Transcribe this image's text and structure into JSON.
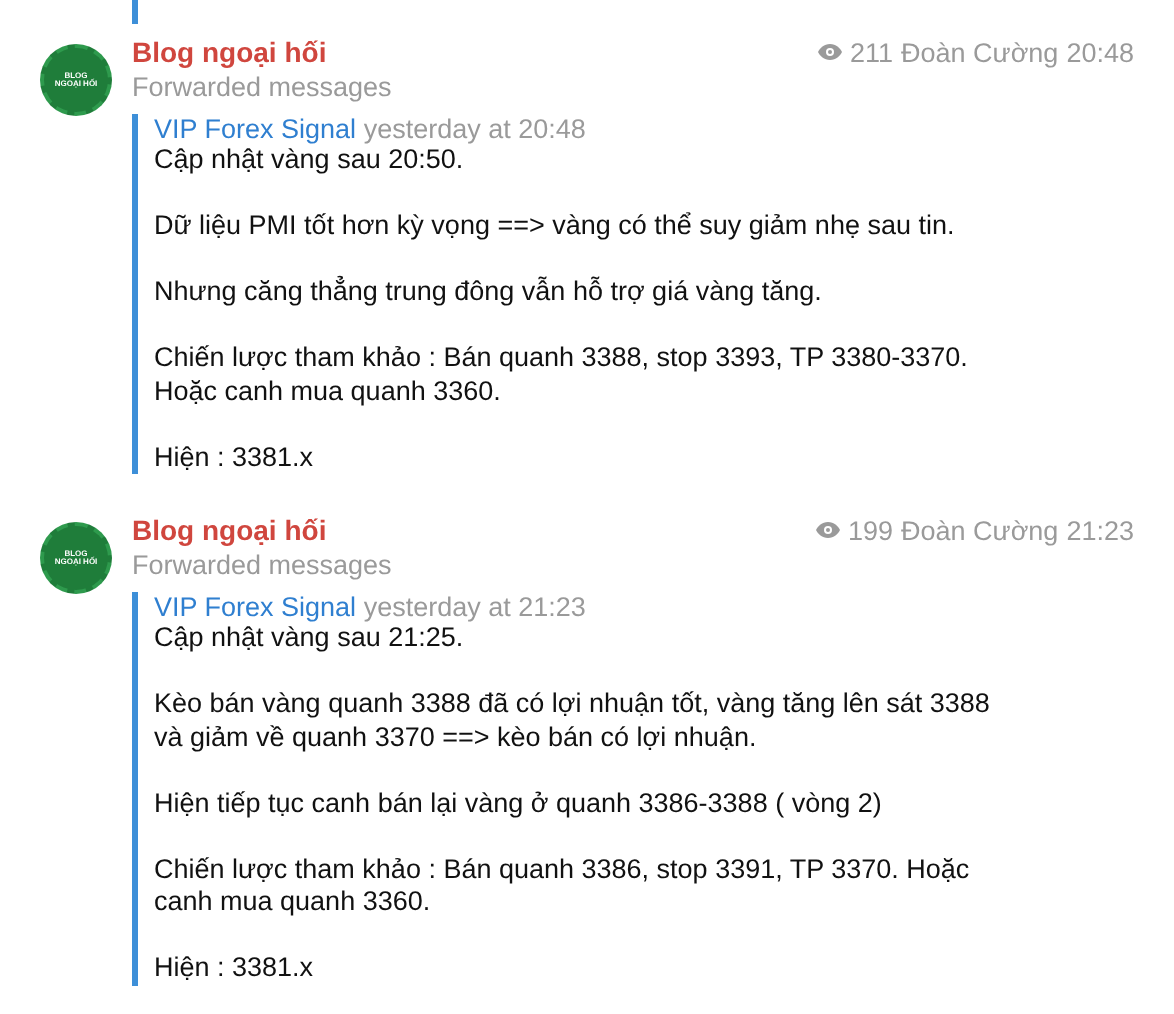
{
  "messages": [
    {
      "channel": "Blog ngoại hối",
      "avatar_text": "BLOG NGOẠI HỐI",
      "subtitle": "Forwarded messages",
      "views": "211",
      "author": "Đoàn Cường",
      "time": "20:48",
      "forward": {
        "source": "VIP Forex Signal",
        "time": "yesterday at 20:48",
        "paragraphs": [
          "Cập nhật vàng sau 20:50.",
          "Dữ liệu PMI tốt hơn kỳ vọng ==> vàng có thể suy giảm nhẹ sau tin.",
          "Nhưng căng thẳng trung đông vẫn hỗ trợ giá vàng tăng.",
          "Chiến lược tham khảo : Bán quanh 3388, stop 3393, TP 3380-3370.\nHoặc canh mua quanh 3360.",
          "Hiện : 3381.x"
        ]
      }
    },
    {
      "channel": "Blog ngoại hối",
      "avatar_text": "BLOG NGOẠI HỐI",
      "subtitle": "Forwarded messages",
      "views": "199",
      "author": "Đoàn Cường",
      "time": "21:23",
      "forward": {
        "source": "VIP Forex Signal",
        "time": "yesterday at 21:23",
        "paragraphs": [
          "Cập nhật vàng sau 21:25.",
          "Kèo bán vàng quanh 3388 đã có lợi nhuận tốt, vàng tăng lên sát 3388\nvà giảm về quanh 3370 ==> kèo bán có lợi nhuận.",
          "Hiện tiếp tục canh bán lại vàng ở quanh 3386-3388 ( vòng 2)",
          "Chiến lược tham khảo : Bán quanh 3386, stop 3391, TP 3370. Hoặc\ncanh mua quanh 3360.",
          "Hiện : 3381.x"
        ]
      }
    }
  ]
}
